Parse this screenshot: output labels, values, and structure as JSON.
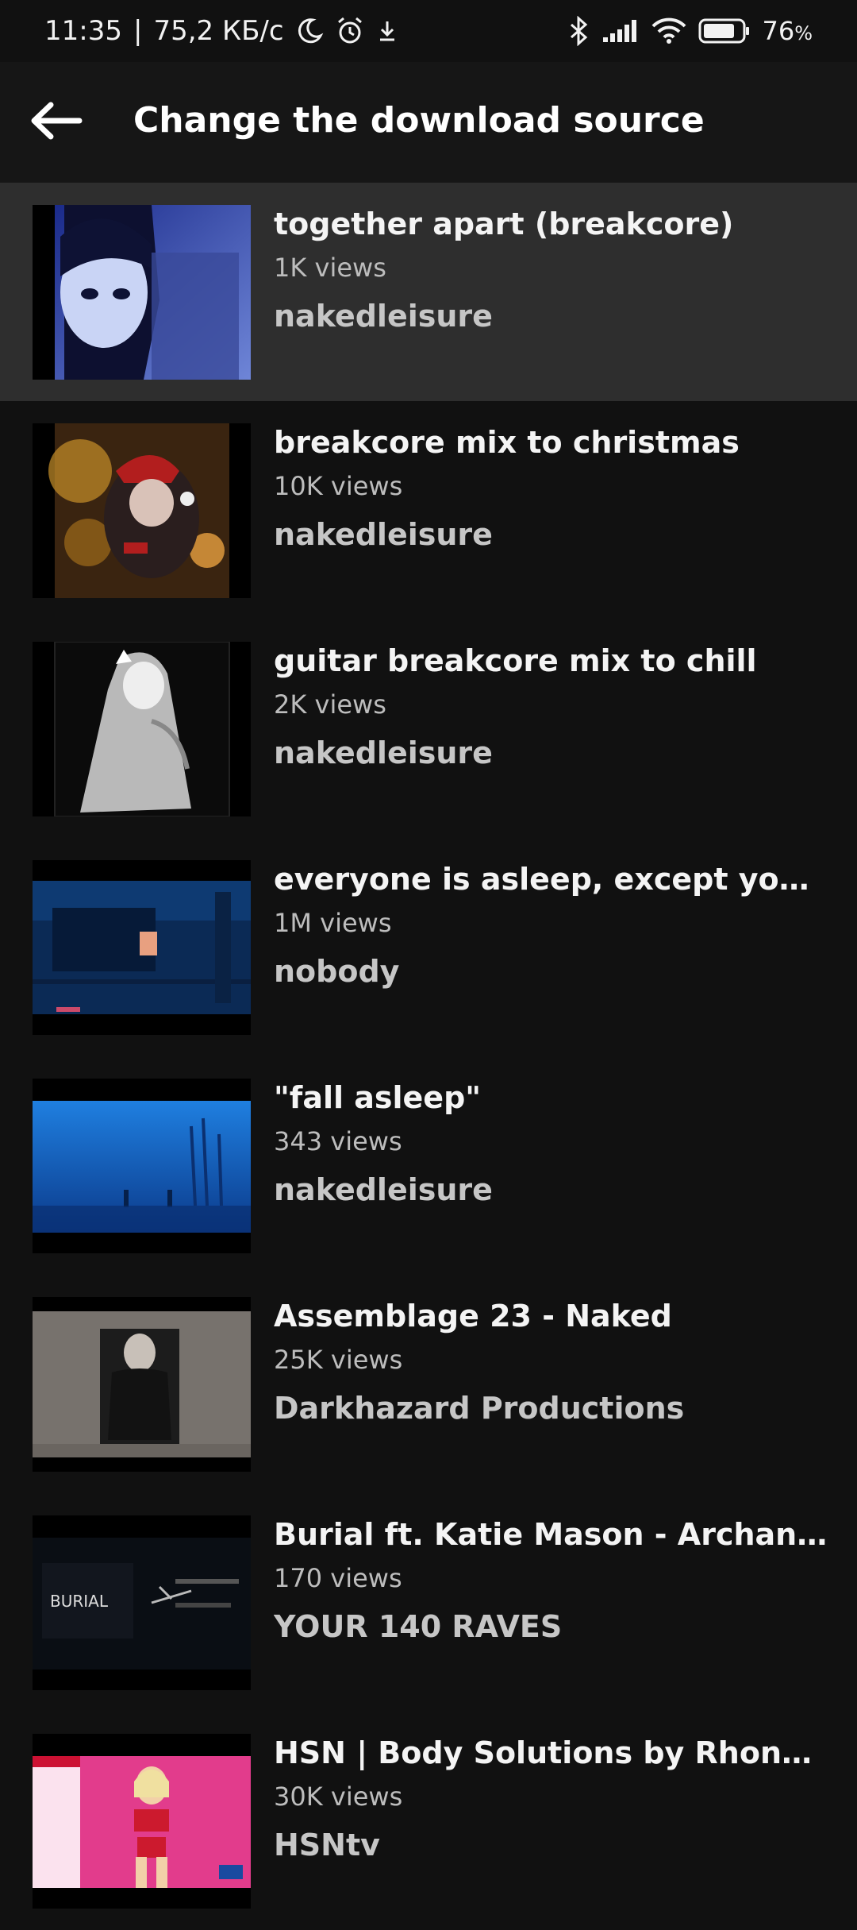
{
  "status_bar": {
    "time": "11:35",
    "net_speed": "75,2 КБ/с",
    "separator": "|",
    "battery_percent": "76",
    "battery_suffix": "%",
    "icons": [
      "moon-icon",
      "alarm-icon",
      "download-icon",
      "bluetooth-icon",
      "signal-icon",
      "wifi-icon",
      "battery-icon"
    ]
  },
  "app_bar": {
    "title": "Change the download source",
    "back_icon": "arrow-left-icon"
  },
  "results": [
    {
      "title": "together apart (breakcore)",
      "views": "1K views",
      "channel": "nakedleisure",
      "selected": true
    },
    {
      "title": "breakcore mix to christmas",
      "views": "10K views",
      "channel": "nakedleisure",
      "selected": false
    },
    {
      "title": "guitar breakcore mix to chill",
      "views": "2K views",
      "channel": "nakedleisure",
      "selected": false
    },
    {
      "title": "everyone is asleep, except you (pl...",
      "views": "1M views",
      "channel": "nobody",
      "selected": false
    },
    {
      "title": "\"fall asleep\"",
      "views": "343 views",
      "channel": "nakedleisure",
      "selected": false
    },
    {
      "title": "Assemblage 23 - Naked",
      "views": "25K views",
      "channel": "Darkhazard Productions",
      "selected": false
    },
    {
      "title": "Burial ft. Katie Mason - Archangel ...",
      "views": "170 views",
      "channel": "YOUR 140 RAVES",
      "selected": false
    },
    {
      "title": "HSN | Body Solutions by Rhonda S...",
      "views": "30K views",
      "channel": "HSNtv",
      "selected": false
    }
  ],
  "thumbnail_logo_text": "BURIAL",
  "colors": {
    "background": "#111111",
    "app_bar": "#161616",
    "selected_row": "#2e2e2e",
    "title_text": "#f4f4f4",
    "secondary_text": "#bdbdbd"
  }
}
